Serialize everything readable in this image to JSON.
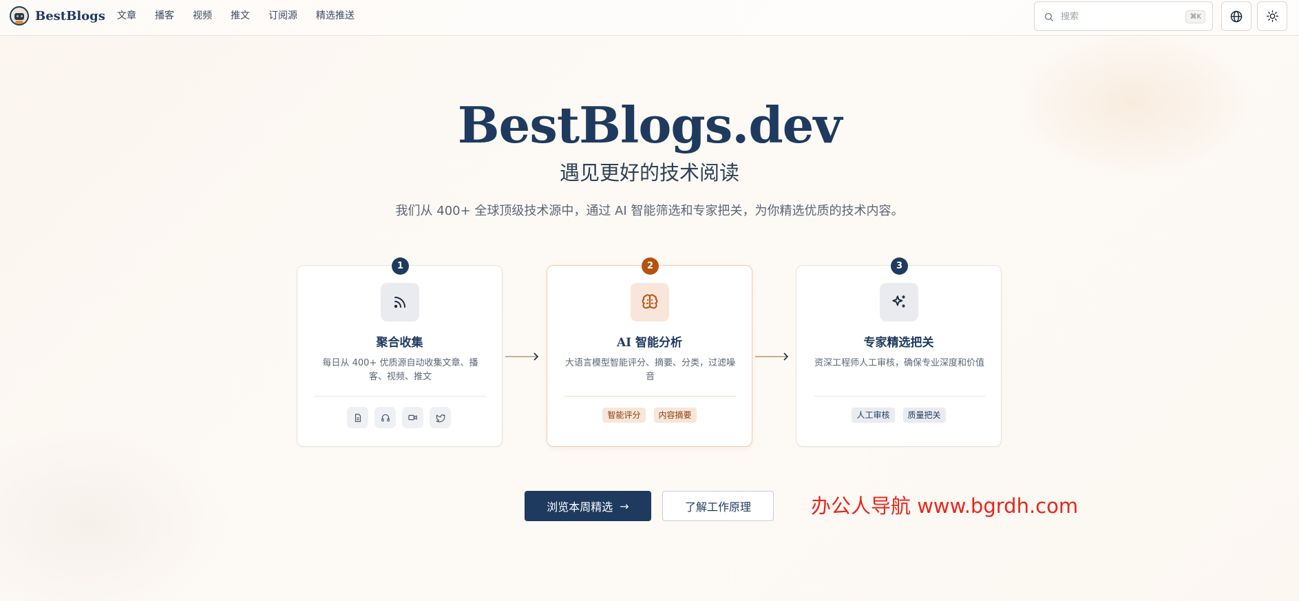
{
  "header": {
    "brand": "BestBlogs",
    "nav": [
      "文章",
      "播客",
      "视频",
      "推文",
      "订阅源",
      "精选推送"
    ],
    "search_placeholder": "搜索",
    "search_shortcut": "⌘K"
  },
  "hero": {
    "title": "BestBlogs.dev",
    "subtitle": "遇见更好的技术阅读",
    "description": "我们从 400+ 全球顶级技术源中，通过 AI 智能筛选和专家把关，为你精选优质的技术内容。"
  },
  "steps": [
    {
      "number": "1",
      "title": "聚合收集",
      "description": "每日从 400+ 优质源自动收集文章、播客、视频、推文",
      "icons": [
        "document-icon",
        "headphones-icon",
        "video-icon",
        "twitter-icon"
      ]
    },
    {
      "number": "2",
      "title": "AI 智能分析",
      "description": "大语言模型智能评分、摘要、分类，过滤噪音",
      "tags": [
        "智能评分",
        "内容摘要"
      ]
    },
    {
      "number": "3",
      "title": "专家精选把关",
      "description": "资深工程师人工审核，确保专业深度和价值",
      "tags": [
        "人工审核",
        "质量把关"
      ]
    }
  ],
  "cta": {
    "primary": "浏览本周精选",
    "secondary": "了解工作原理"
  },
  "watermark": "办公人导航  www.bgrdh.com",
  "colors": {
    "navy": "#1e3a5f",
    "accent_orange": "#b4530f",
    "watermark_red": "#e8261d"
  }
}
